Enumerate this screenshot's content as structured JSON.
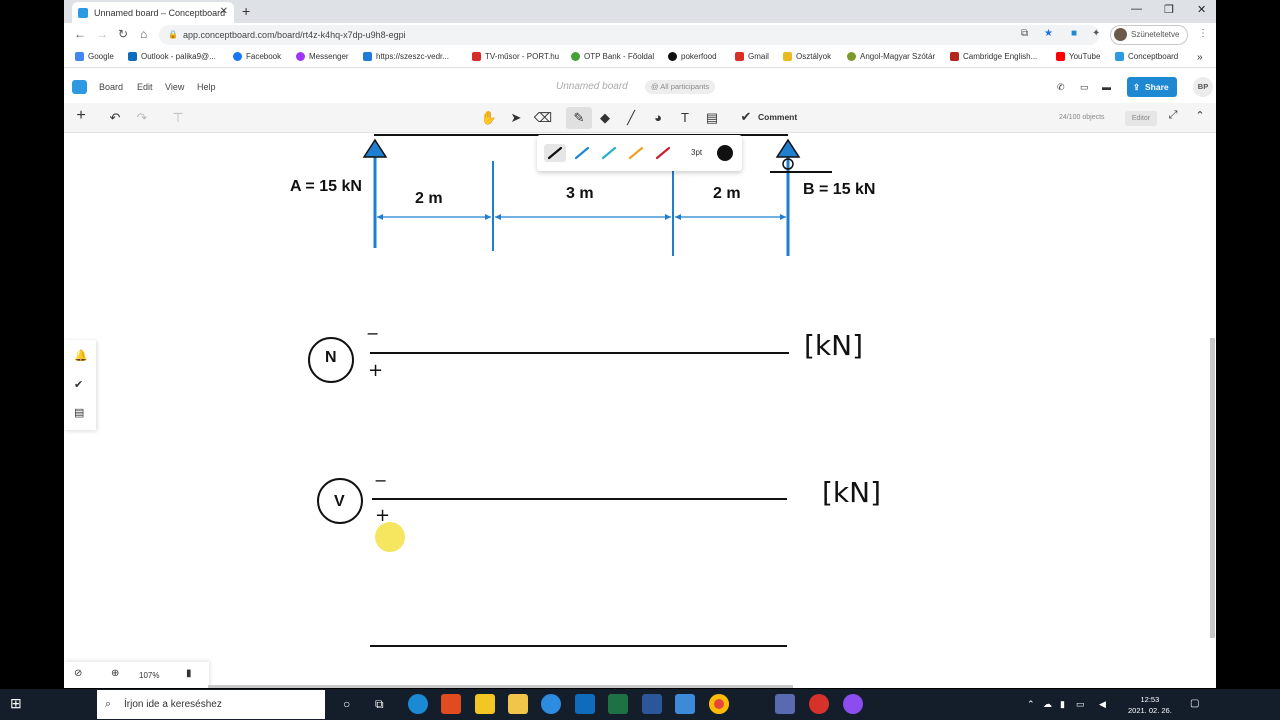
{
  "browser": {
    "tab_title": "Unnamed board – Conceptboard",
    "url": "app.conceptboard.com/board/rt4z-k4hq-x7dp-u9h8-egpi",
    "profile_label": "Szüneteltetve",
    "bookmarks": [
      {
        "label": "Google",
        "color": "#4285f4"
      },
      {
        "label": "Outlook - palika9@...",
        "color": "#0f6cbd"
      },
      {
        "label": "Facebook",
        "color": "#1877f2"
      },
      {
        "label": "Messenger",
        "color": "#a334fa"
      },
      {
        "label": "https://szeszc-vedr...",
        "color": "#1e7bd6"
      },
      {
        "label": "TV-műsor - PORT.hu",
        "color": "#d52b2b"
      },
      {
        "label": "OTP Bank - Főoldal",
        "color": "#46a035"
      },
      {
        "label": "pokerfood",
        "color": "#111111"
      },
      {
        "label": "Gmail",
        "color": "#d93025"
      },
      {
        "label": "Osztályok",
        "color": "#e8b923"
      },
      {
        "label": "Angol-Magyar Szótár",
        "color": "#7a9a2a"
      },
      {
        "label": "Cambridge English...",
        "color": "#b3261e"
      },
      {
        "label": "YouTube",
        "color": "#ff0000"
      },
      {
        "label": "Conceptboard",
        "color": "#2c9ae2"
      }
    ]
  },
  "app": {
    "menu": [
      "Board",
      "Edit",
      "View",
      "Help"
    ],
    "board_title": "Unnamed board",
    "participants": "All participants",
    "share_label": "Share",
    "user_initials": "BP",
    "comment_label": "Comment",
    "objects_count": "24/100 objects",
    "role_badge": "Editor",
    "pen_size": "3pt",
    "pen_colors": [
      "#111111",
      "#1e88d2",
      "#2ab0c8",
      "#f0a020",
      "#cc1f2f"
    ],
    "zoom": "107%"
  },
  "canvas": {
    "label_a": "A = 15 kN",
    "label_b": "B = 15 kN",
    "span_1": "2 m",
    "span_2": "3 m",
    "span_3": "2 m",
    "diagram_n": "N",
    "diagram_v": "V",
    "minus": "−",
    "plus": "+",
    "unit_n": "[kN]",
    "unit_v": "[kN]"
  },
  "taskbar": {
    "search_placeholder": "Írjon ide a kereséshez",
    "time": "12:53",
    "date": "2021. 02. 26."
  }
}
